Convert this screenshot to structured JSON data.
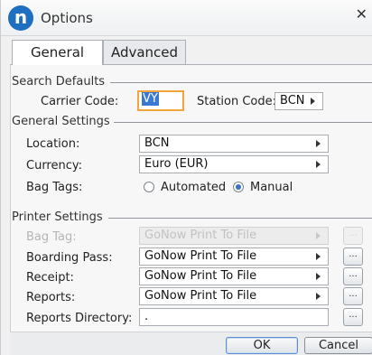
{
  "window": {
    "title": "Options",
    "logo_letter": "n",
    "close_glyph": "✕"
  },
  "tabs": [
    {
      "label": "General"
    },
    {
      "label": "Advanced"
    }
  ],
  "search_defaults": {
    "section_title": "Search Defaults",
    "carrier_code_label": "Carrier Code:",
    "carrier_code_value": "VY",
    "station_code_label": "Station Code:",
    "station_code_value": "BCN"
  },
  "general_settings": {
    "section_title": "General Settings",
    "location_label": "Location:",
    "location_value": "BCN",
    "currency_label": "Currency:",
    "currency_value": "Euro (EUR)",
    "bag_tags_label": "Bag Tags:",
    "bag_tags_options": [
      "Automated",
      "Manual"
    ],
    "bag_tags_selected": "Manual"
  },
  "printer_settings": {
    "section_title": "Printer Settings",
    "bag_tag_label": "Bag Tag:",
    "bag_tag_value": "GoNow Print To File",
    "boarding_pass_label": "Boarding Pass:",
    "boarding_pass_value": "GoNow Print To File",
    "receipt_label": "Receipt:",
    "receipt_value": "GoNow Print To File",
    "reports_label": "Reports:",
    "reports_value": "GoNow Print To File",
    "reports_directory_label": "Reports Directory:",
    "reports_directory_value": ".",
    "browse_label": "..."
  },
  "buttons": {
    "ok_label": "OK",
    "cancel_label": "Cancel"
  },
  "colors": {
    "accent": "#1e6fc0",
    "focus": "#f3a53b",
    "selection": "#3b78d3"
  }
}
